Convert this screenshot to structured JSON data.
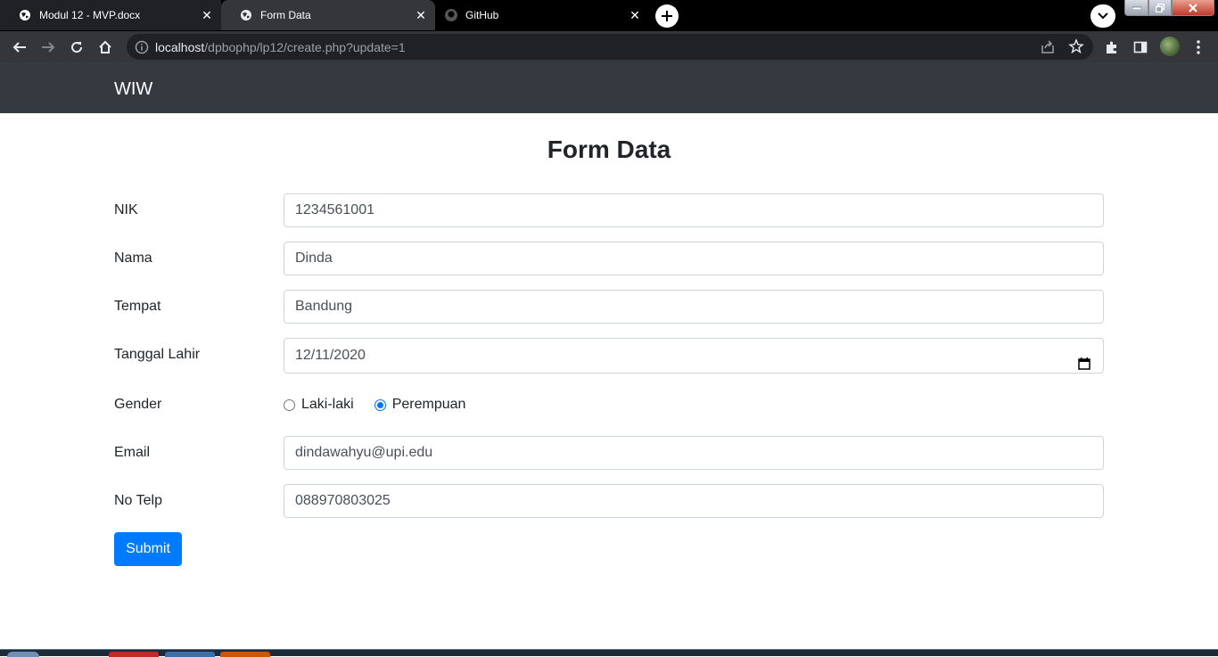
{
  "browser": {
    "tabs": [
      {
        "title": "Modul 12 - MVP.docx",
        "icon": "globe-icon",
        "active": false
      },
      {
        "title": "Form Data",
        "icon": "globe-icon",
        "active": true
      },
      {
        "title": "GitHub",
        "icon": "github-icon",
        "active": false
      }
    ],
    "close_glyph": "✕",
    "new_tab_glyph": "+",
    "url_host": "localhost",
    "url_path": "/dpbophp/lp12/create.php?update=1"
  },
  "navbar": {
    "brand": "WIW"
  },
  "form": {
    "title": "Form Data",
    "fields": {
      "nik": {
        "label": "NIK",
        "value": "1234561001"
      },
      "nama": {
        "label": "Nama",
        "value": "Dinda"
      },
      "tempat": {
        "label": "Tempat",
        "value": "Bandung"
      },
      "tanggal_lahir": {
        "label": "Tanggal Lahir",
        "value": "12/11/2020"
      },
      "gender": {
        "label": "Gender",
        "options": [
          "Laki-laki",
          "Perempuan"
        ],
        "selected": "Perempuan"
      },
      "email": {
        "label": "Email",
        "value": "dindawahyu@upi.edu"
      },
      "no_telp": {
        "label": "No Telp",
        "value": "088970803025"
      }
    },
    "submit_label": "Submit"
  },
  "colors": {
    "primary": "#007bff",
    "navbar": "#343a40",
    "radio_accent": "#0075ff"
  }
}
